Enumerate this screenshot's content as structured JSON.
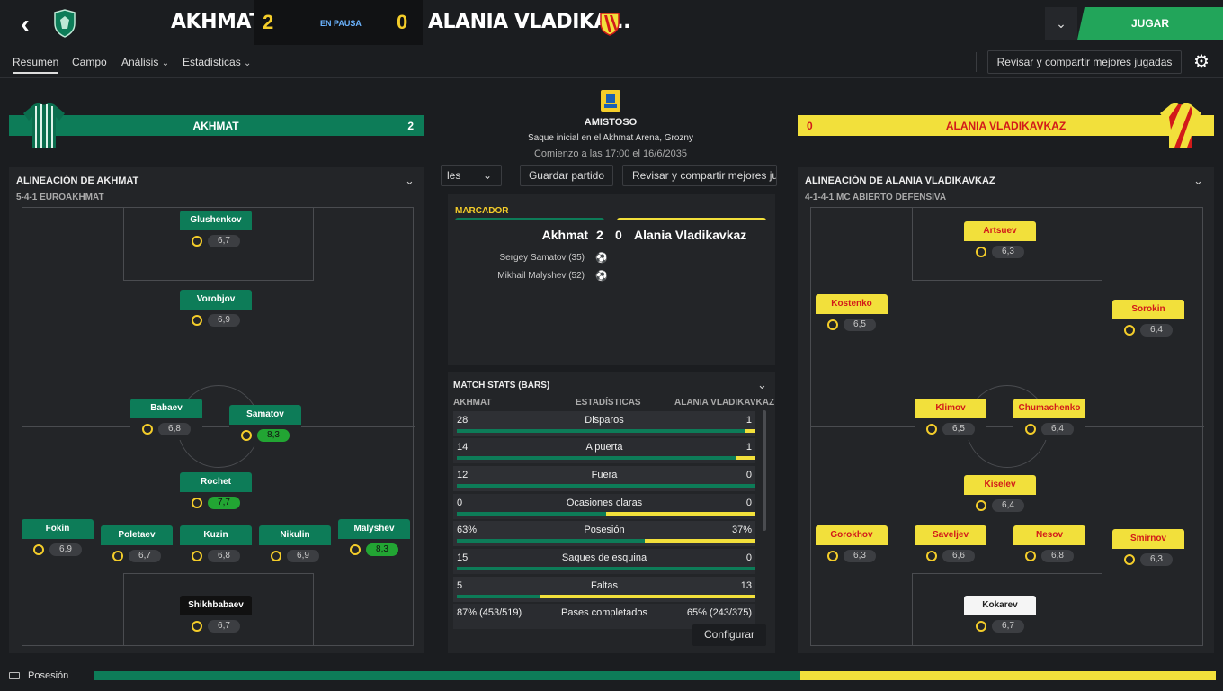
{
  "header": {
    "home_team": "AKHMAT",
    "home_score": "2",
    "status": "EN PAUSA",
    "away_score": "0",
    "away_team": "ALANIA VLADIKA...",
    "play_button": "JUGAR"
  },
  "nav": {
    "tabs": [
      "Resumen",
      "Campo",
      "Análisis",
      "Estadísticas"
    ],
    "review_button": "Revisar y compartir mejores jugadas"
  },
  "center": {
    "competition": "AMISTOSO",
    "venue": "Saque inicial en el Akhmat Arena, Grozny",
    "kickoff": "Comienzo a las 17:00 el 16/6/2035",
    "toolbar_left": "les",
    "save_button": "Guardar partido",
    "review_button": "Revisar y compartir mejores ju"
  },
  "scoreboard": {
    "title": "MARCADOR",
    "home": "Akhmat",
    "home_goals": "2",
    "away_goals": "0",
    "away": "Alania Vladikavkaz",
    "scorers": [
      "Sergey Samatov (35)",
      "Mikhail Malyshev (52)"
    ]
  },
  "stats": {
    "title": "MATCH STATS (BARS)",
    "col_home": "AKHMAT",
    "col_mid": "ESTADÍSTICAS",
    "col_away": "ALANIA VLADIKAVKAZ",
    "rows": [
      {
        "home": "28",
        "label": "Disparos",
        "away": "1",
        "home_frac": 0.966
      },
      {
        "home": "14",
        "label": "A puerta",
        "away": "1",
        "home_frac": 0.933
      },
      {
        "home": "12",
        "label": "Fuera",
        "away": "0",
        "home_frac": 1.0
      },
      {
        "home": "0",
        "label": "Ocasiones claras",
        "away": "0",
        "home_frac": 0.5
      },
      {
        "home": "63%",
        "label": "Posesión",
        "away": "37%",
        "home_frac": 0.63
      },
      {
        "home": "15",
        "label": "Saques de esquina",
        "away": "0",
        "home_frac": 1.0
      },
      {
        "home": "5",
        "label": "Faltas",
        "away": "13",
        "home_frac": 0.28
      },
      {
        "home": "87% (453/519)",
        "label": "Pases completados",
        "away": "65% (243/375)",
        "home_frac": null
      }
    ],
    "configure_button": "Configurar"
  },
  "home_panel": {
    "bar_name": "AKHMAT",
    "bar_score": "2",
    "lineup_title": "ALINEACIÓN DE AKHMAT",
    "formation": "5-4-1 EUROAKHMAT",
    "players": [
      {
        "name": "Glushenkov",
        "rating": "6,7"
      },
      {
        "name": "Vorobjov",
        "rating": "6,9"
      },
      {
        "name": "Babaev",
        "rating": "6,8"
      },
      {
        "name": "Samatov",
        "rating": "8,3"
      },
      {
        "name": "Rochet",
        "rating": "7,7"
      },
      {
        "name": "Fokin",
        "rating": "6,9"
      },
      {
        "name": "Poletaev",
        "rating": "6,7"
      },
      {
        "name": "Kuzin",
        "rating": "6,8"
      },
      {
        "name": "Nikulin",
        "rating": "6,9"
      },
      {
        "name": "Malyshev",
        "rating": "8,3"
      },
      {
        "name": "Shikhbabaev",
        "rating": "6,7"
      }
    ]
  },
  "away_panel": {
    "bar_score": "0",
    "bar_name": "ALANIA VLADIKAVKAZ",
    "lineup_title": "ALINEACIÓN DE ALANIA VLADIKAVKAZ",
    "formation": "4-1-4-1 MC ABIERTO DEFENSIVA",
    "players": [
      {
        "name": "Artsuev",
        "rating": "6,3"
      },
      {
        "name": "Kostenko",
        "rating": "6,5"
      },
      {
        "name": "Sorokin",
        "rating": "6,4"
      },
      {
        "name": "Klimov",
        "rating": "6,5"
      },
      {
        "name": "Chumachenko",
        "rating": "6,4"
      },
      {
        "name": "Kiselev",
        "rating": "6,4"
      },
      {
        "name": "Gorokhov",
        "rating": "6,3"
      },
      {
        "name": "Saveljev",
        "rating": "6,6"
      },
      {
        "name": "Nesov",
        "rating": "6,8"
      },
      {
        "name": "Smirnov",
        "rating": "6,3"
      },
      {
        "name": "Kokarev",
        "rating": "6,7"
      }
    ]
  },
  "footer": {
    "label": "Posesión",
    "home_possession": 0.63
  },
  "colors": {
    "home": "#0d7c58",
    "away": "#f2e03b",
    "accent_green": "#22a55a",
    "gold": "#f4cd2a"
  }
}
